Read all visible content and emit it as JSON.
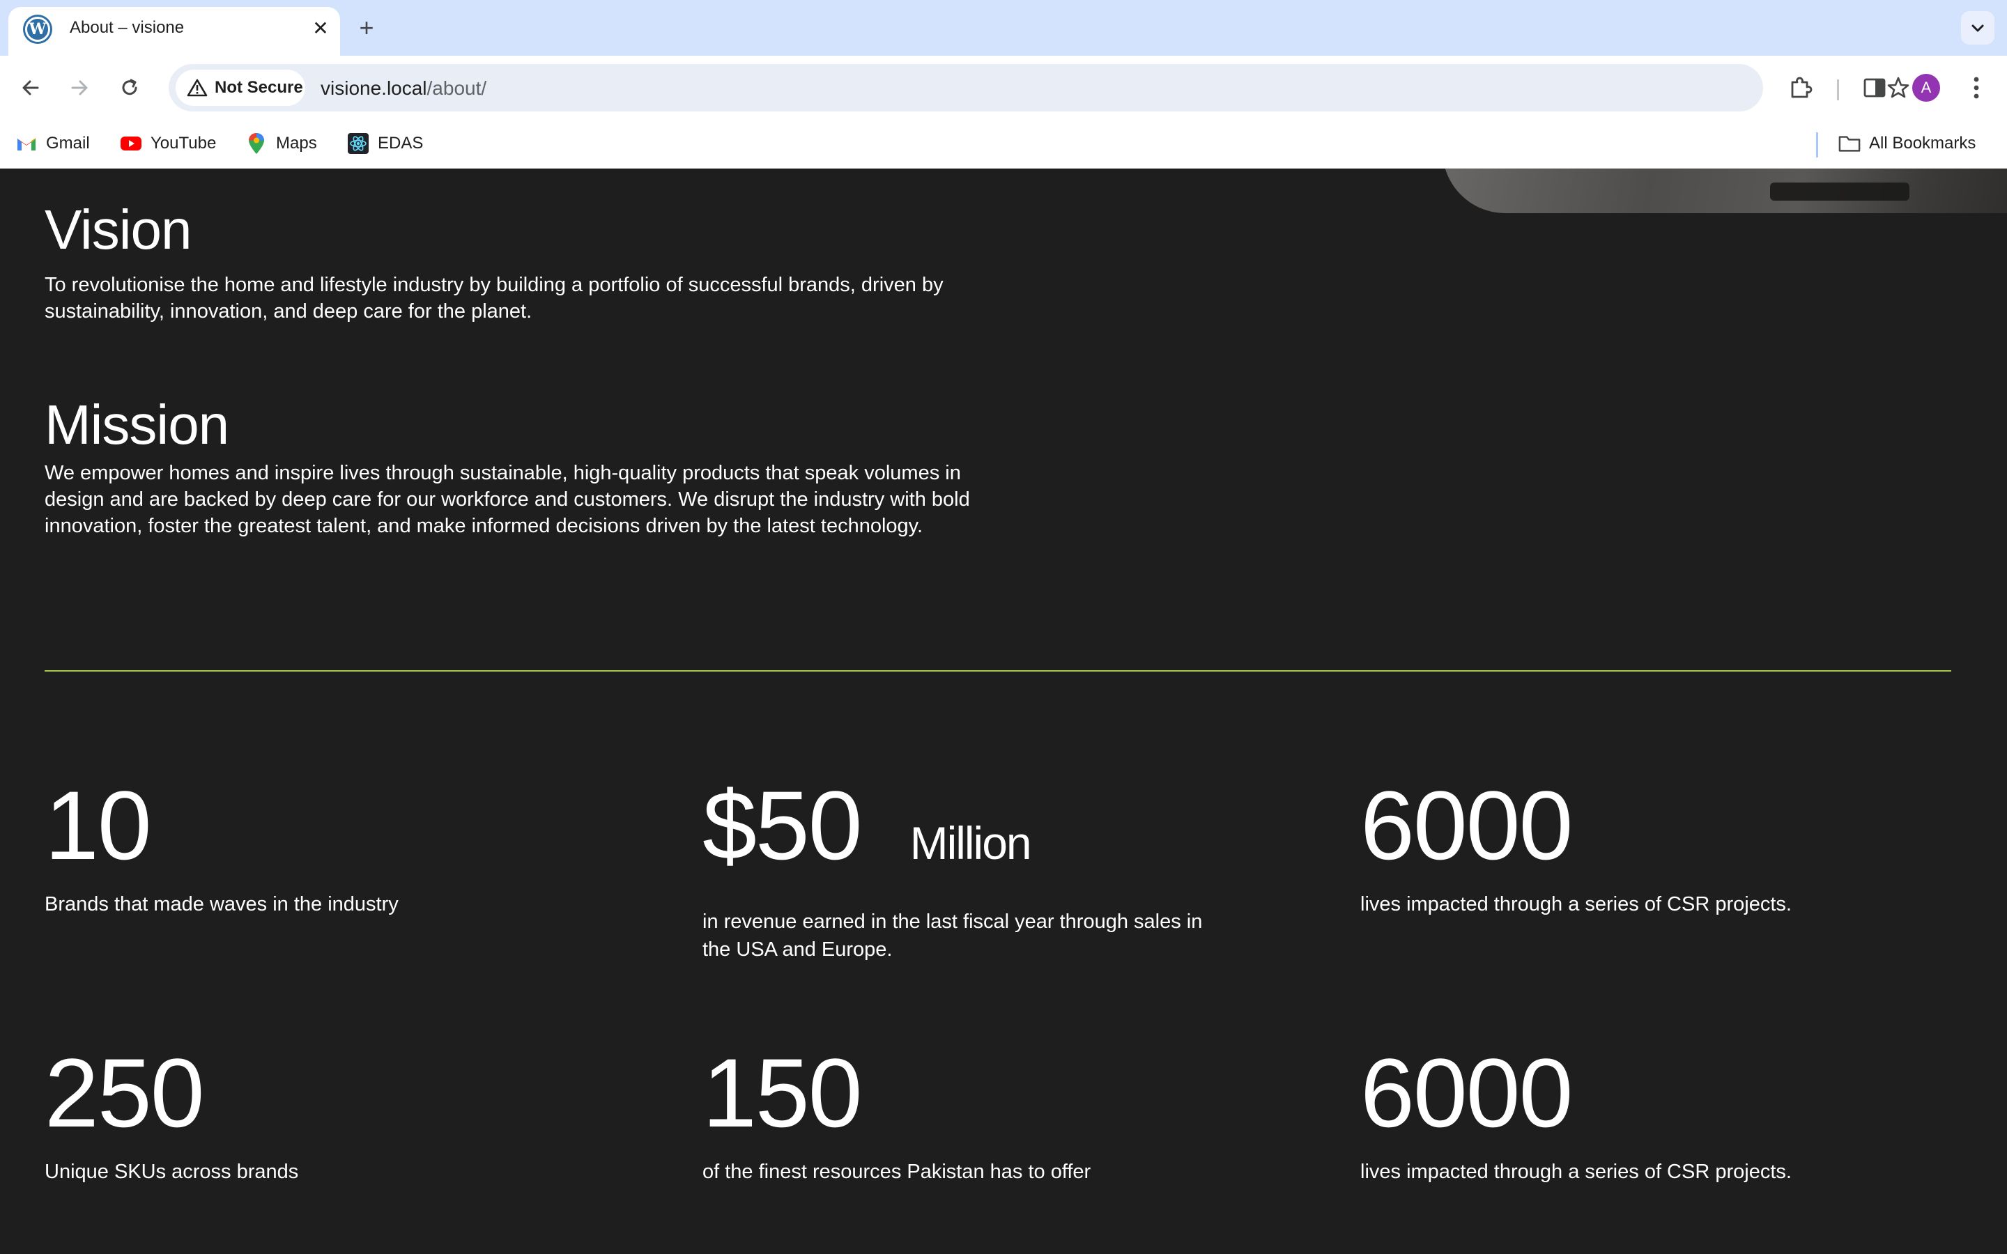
{
  "browser": {
    "tab": {
      "title": "About – visione",
      "favicon": "wordpress-icon"
    },
    "new_tab_label": "+",
    "address": {
      "security_label": "Not Secure",
      "host": "visione.local",
      "path": "/about/"
    },
    "profile_initial": "A",
    "bookmarks": [
      {
        "label": "Gmail",
        "icon": "gmail-icon"
      },
      {
        "label": "YouTube",
        "icon": "youtube-icon"
      },
      {
        "label": "Maps",
        "icon": "maps-icon"
      },
      {
        "label": "EDAS",
        "icon": "edas-icon"
      }
    ],
    "all_bookmarks_label": "All Bookmarks"
  },
  "page": {
    "vision": {
      "title": "Vision",
      "text": "To revolutionise the home and lifestyle industry by building a portfolio of successful brands, driven by sustainability, innovation, and deep care for the planet."
    },
    "mission": {
      "title": "Mission",
      "text": "We empower homes and inspire lives through sustainable, high-quality products that speak volumes in design and are backed by deep care for our workforce and customers. We disrupt the industry with bold innovation, foster the greatest talent, and make informed decisions driven by the latest technology."
    },
    "stats": [
      {
        "value": "10",
        "unit": "",
        "text": "Brands that made waves in the industry"
      },
      {
        "value": "$50",
        "unit": "Million",
        "text": "in revenue earned in the last fiscal year through sales in the USA and Europe."
      },
      {
        "value": "6000",
        "unit": "",
        "text": "lives impacted through a series of CSR projects."
      },
      {
        "value": "250",
        "unit": "",
        "text": "Unique SKUs across brands"
      },
      {
        "value": "150",
        "unit": "",
        "text": "of the finest resources Pakistan has to offer"
      },
      {
        "value": "6000",
        "unit": "",
        "text": "lives impacted through a series of CSR projects."
      }
    ],
    "colors": {
      "background": "#1e1e1e",
      "divider": "#a5c94a",
      "text": "#ffffff"
    }
  }
}
